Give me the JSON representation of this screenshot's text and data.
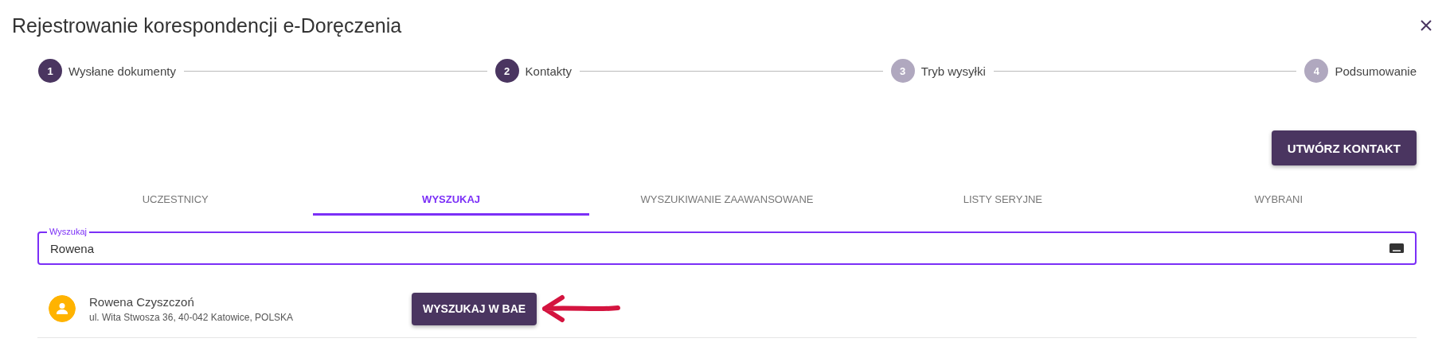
{
  "dialog": {
    "title": "Rejestrowanie korespondencji e-Doręczenia"
  },
  "steps": [
    {
      "number": "1",
      "label": "Wysłane dokumenty",
      "active": true
    },
    {
      "number": "2",
      "label": "Kontakty",
      "active": true
    },
    {
      "number": "3",
      "label": "Tryb wysyłki",
      "active": false
    },
    {
      "number": "4",
      "label": "Podsumowanie",
      "active": false
    }
  ],
  "create_button": "UTWÓRZ KONTAKT",
  "tabs": [
    {
      "label": "UCZESTNICY",
      "selected": false
    },
    {
      "label": "WYSZUKAJ",
      "selected": true
    },
    {
      "label": "WYSZUKIWANIE ZAAWANSOWANE",
      "selected": false
    },
    {
      "label": "LISTY SERYJNE",
      "selected": false
    },
    {
      "label": "WYBRANI",
      "selected": false
    }
  ],
  "search": {
    "label": "Wyszukaj",
    "value": "Rowena"
  },
  "results": [
    {
      "name": "Rowena Czyszczoń",
      "address": "ul. Wita Stwosza 36, 40-042 Katowice, POLSKA"
    }
  ],
  "bae_button": "WYSZUKAJ W BAE"
}
